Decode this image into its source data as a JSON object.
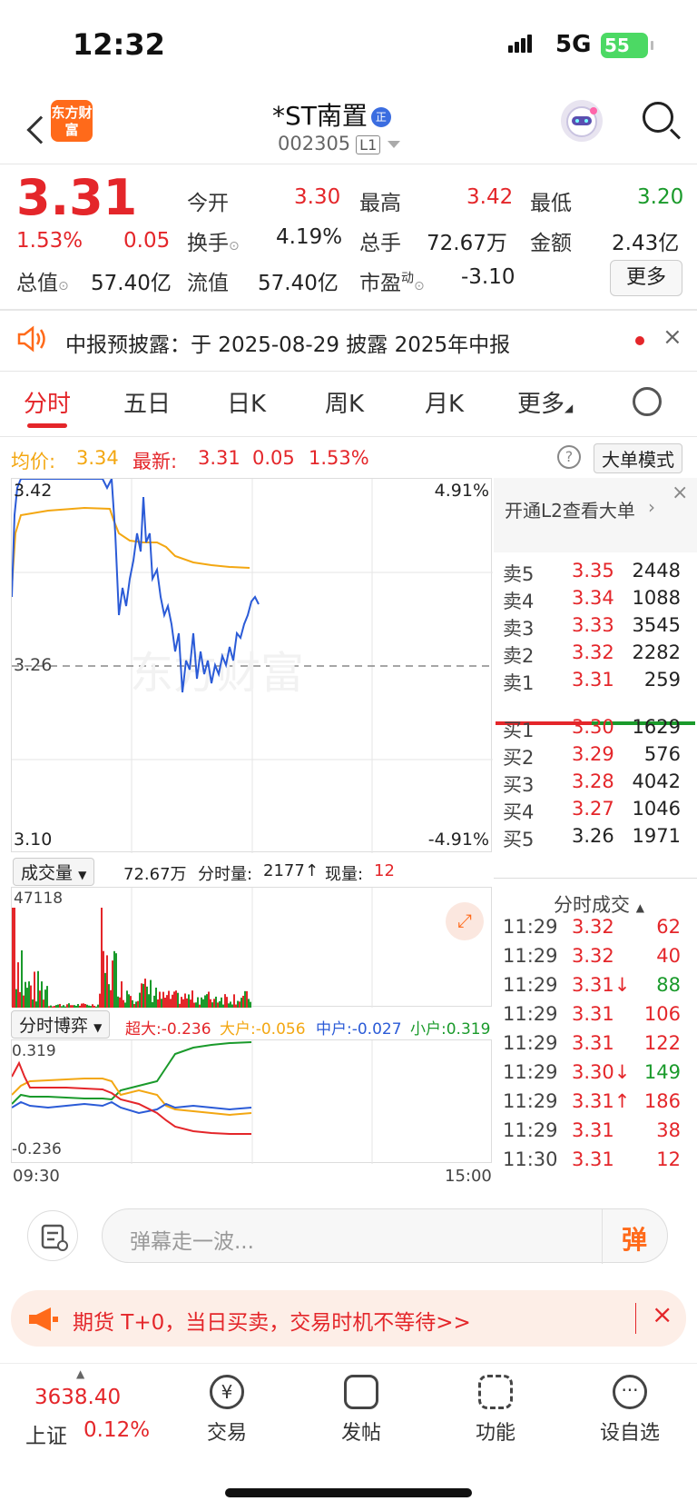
{
  "status": {
    "time": "12:32",
    "network": "5G",
    "battery": "55"
  },
  "header": {
    "logo": "东方财富",
    "title": "*ST南置",
    "badge": "正",
    "code": "002305",
    "level": "L1"
  },
  "quote": {
    "price": "3.31",
    "pct": "1.53%",
    "chg": "0.05",
    "open_lbl": "今开",
    "open": "3.30",
    "high_lbl": "最高",
    "high": "3.42",
    "low_lbl": "最低",
    "low": "3.20",
    "turn_lbl": "换手",
    "turn": "4.19%",
    "vol_lbl": "总手",
    "vol": "72.67万",
    "amt_lbl": "金额",
    "amt": "2.43亿",
    "mcap_lbl": "总值",
    "mcap": "57.40亿",
    "float_lbl": "流值",
    "float": "57.40亿",
    "pe_lbl": "市盈",
    "pe_sup": "动",
    "pe": "-3.10",
    "more": "更多"
  },
  "notice": {
    "text": "中报预披露：于 2025-08-29 披露 2025年中报"
  },
  "tabs": [
    "分时",
    "五日",
    "日K",
    "周K",
    "月K",
    "更多"
  ],
  "info": {
    "avg_lbl": "均价:",
    "avg": "3.34",
    "last_lbl": "最新:",
    "last": "3.31",
    "chg": "0.05",
    "pct": "1.53%",
    "mode": "大单模式"
  },
  "chart": {
    "y_top": "3.42",
    "y_mid": "3.26",
    "y_bot": "3.10",
    "pct_top": "4.91%",
    "pct_bot": "-4.91%",
    "watermark": "东方财富"
  },
  "book": {
    "l2_text": "开通L2查看大单",
    "sells": [
      {
        "l": "卖5",
        "p": "3.35",
        "v": "2448"
      },
      {
        "l": "卖4",
        "p": "3.34",
        "v": "1088"
      },
      {
        "l": "卖3",
        "p": "3.33",
        "v": "3545"
      },
      {
        "l": "卖2",
        "p": "3.32",
        "v": "2282"
      },
      {
        "l": "卖1",
        "p": "3.31",
        "v": "259"
      }
    ],
    "buys": [
      {
        "l": "买1",
        "p": "3.30",
        "v": "1629"
      },
      {
        "l": "买2",
        "p": "3.29",
        "v": "576"
      },
      {
        "l": "买3",
        "p": "3.28",
        "v": "4042"
      },
      {
        "l": "买4",
        "p": "3.27",
        "v": "1046"
      },
      {
        "l": "买5",
        "p": "3.26",
        "v": "1971"
      }
    ],
    "trades_lbl": "分时成交",
    "trades": [
      {
        "t": "11:29",
        "p": "3.32",
        "v": "62"
      },
      {
        "t": "11:29",
        "p": "3.32",
        "v": "40"
      },
      {
        "t": "11:29",
        "p": "3.31↓",
        "v": "88"
      },
      {
        "t": "11:29",
        "p": "3.31",
        "v": "106"
      },
      {
        "t": "11:29",
        "p": "3.31",
        "v": "122"
      },
      {
        "t": "11:29",
        "p": "3.30↓",
        "v": "149"
      },
      {
        "t": "11:29",
        "p": "3.31↑",
        "v": "186"
      },
      {
        "t": "11:29",
        "p": "3.31",
        "v": "38"
      },
      {
        "t": "11:30",
        "p": "3.31",
        "v": "12"
      }
    ]
  },
  "volume": {
    "lbl": "成交量",
    "total": "72.67万",
    "fs_lbl": "分时量:",
    "fs": "2177",
    "cur_lbl": "现量:",
    "cur": "12",
    "max": "47118"
  },
  "bygame": {
    "lbl": "分时博弈",
    "sd": "超大:-0.236",
    "dh": "大户:-0.056",
    "zh": "中户:-0.027",
    "xh": "小户:0.319",
    "top": "0.319",
    "bot": "-0.236",
    "t0": "09:30",
    "t1": "15:00"
  },
  "comment": {
    "placeholder": "弹幕走一波...",
    "btn": "弹"
  },
  "ad": {
    "text": "期货 T+0，当日买卖，交易时机不等待>>"
  },
  "nav": {
    "index_val": "3638.40",
    "index_name": "上证",
    "index_pct": "0.12%",
    "items": [
      "交易",
      "发帖",
      "功能",
      "设自选"
    ]
  }
}
